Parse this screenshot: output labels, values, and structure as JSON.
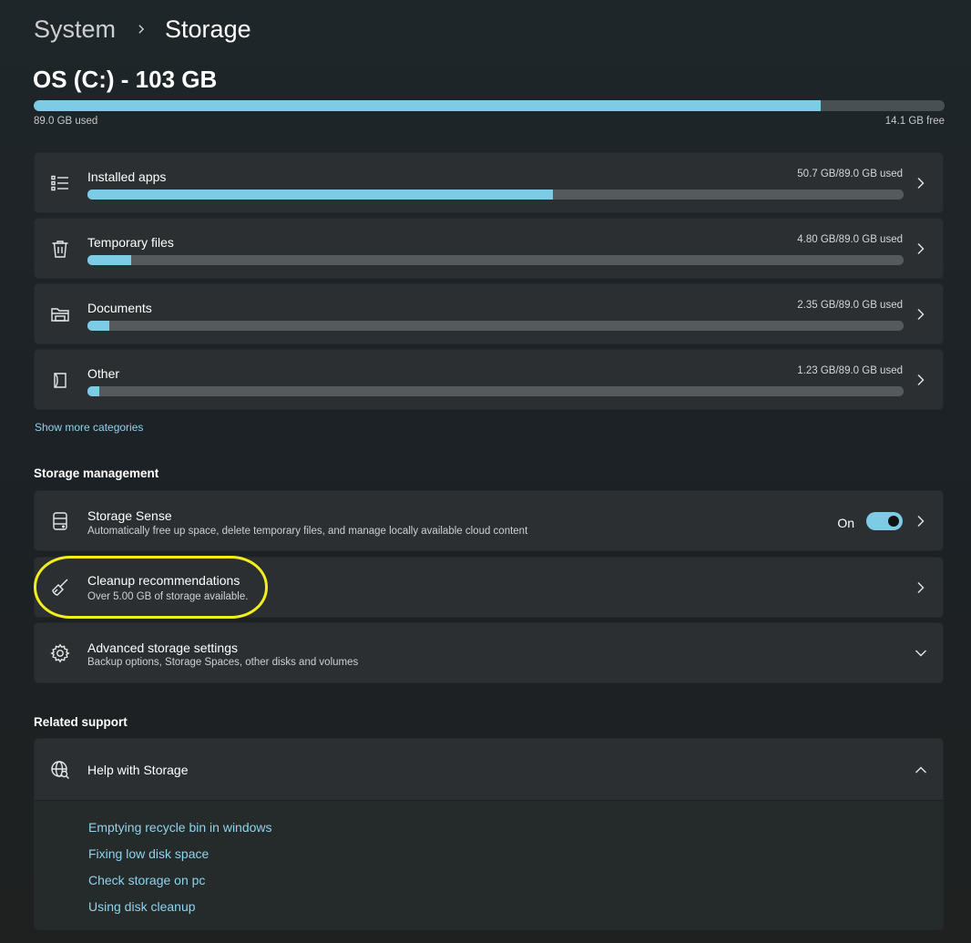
{
  "breadcrumb": {
    "parent": "System",
    "current": "Storage"
  },
  "drive": {
    "title": "OS (C:) - 103 GB",
    "used_label": "89.0 GB used",
    "free_label": "14.1 GB free",
    "used_fraction": 0.864
  },
  "categories": [
    {
      "label": "Installed apps",
      "usage": "50.7 GB/89.0 GB used",
      "fraction": 0.57,
      "icon": "list-icon"
    },
    {
      "label": "Temporary files",
      "usage": "4.80 GB/89.0 GB used",
      "fraction": 0.054,
      "icon": "trash-icon"
    },
    {
      "label": "Documents",
      "usage": "2.35 GB/89.0 GB used",
      "fraction": 0.027,
      "icon": "folder-icon"
    },
    {
      "label": "Other",
      "usage": "1.23 GB/89.0 GB used",
      "fraction": 0.014,
      "icon": "document-icon"
    }
  ],
  "show_more": "Show more categories",
  "storage_management": {
    "heading": "Storage management",
    "storage_sense": {
      "title": "Storage Sense",
      "subtitle": "Automatically free up space, delete temporary files, and manage locally available cloud content",
      "toggle_state": "On",
      "icon": "storage-drive-icon"
    },
    "cleanup": {
      "title": "Cleanup recommendations",
      "subtitle": "Over 5.00 GB of storage available.",
      "icon": "broom-icon"
    },
    "advanced": {
      "title": "Advanced storage settings",
      "subtitle": "Backup options, Storage Spaces, other disks and volumes",
      "icon": "gear-icon"
    }
  },
  "related_support": {
    "heading": "Related support",
    "help": {
      "title": "Help with Storage",
      "icon": "globe-search-icon",
      "links": [
        "Emptying recycle bin in windows",
        "Fixing low disk space",
        "Check storage on pc",
        "Using disk cleanup"
      ]
    }
  },
  "colors": {
    "accent": "#7ecbe6",
    "link": "#8fd3ec",
    "highlight": "#f2ef1a",
    "card": "#2b2f31"
  }
}
